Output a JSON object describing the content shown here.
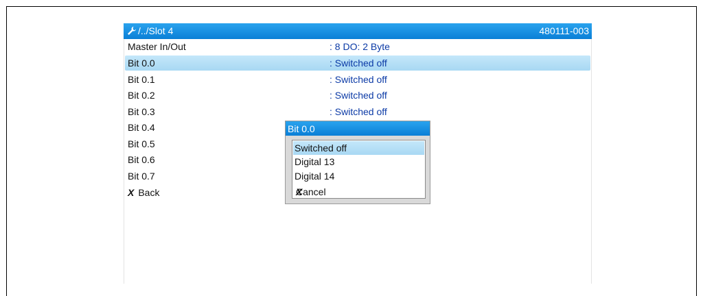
{
  "header": {
    "path": "/../Slot 4",
    "device_id": "480111-003"
  },
  "rows": [
    {
      "label": "Master In/Out",
      "value": ": 8 DO: 2 Byte"
    },
    {
      "label": "Bit 0.0",
      "value": ": Switched off"
    },
    {
      "label": "Bit 0.1",
      "value": ": Switched off"
    },
    {
      "label": "Bit 0.2",
      "value": ": Switched off"
    },
    {
      "label": "Bit 0.3",
      "value": ": Switched off"
    },
    {
      "label": "Bit 0.4",
      "value": ""
    },
    {
      "label": "Bit 0.5",
      "value": ""
    },
    {
      "label": "Bit 0.6",
      "value": ""
    },
    {
      "label": "Bit 0.7",
      "value": ""
    }
  ],
  "back_label": "Back",
  "popup": {
    "title": "Bit 0.0",
    "options": [
      "Switched off",
      "Digital 13",
      "Digital 14"
    ],
    "cancel_label": "Cancel"
  },
  "x_glyph": "X",
  "colors": {
    "title_bar": "#1a8fe3",
    "value_text": "#0b3aa6",
    "selection": "#b8e0f7"
  },
  "icons": {
    "header": "wrench-icon",
    "back": "x-icon",
    "cancel": "x-icon"
  }
}
